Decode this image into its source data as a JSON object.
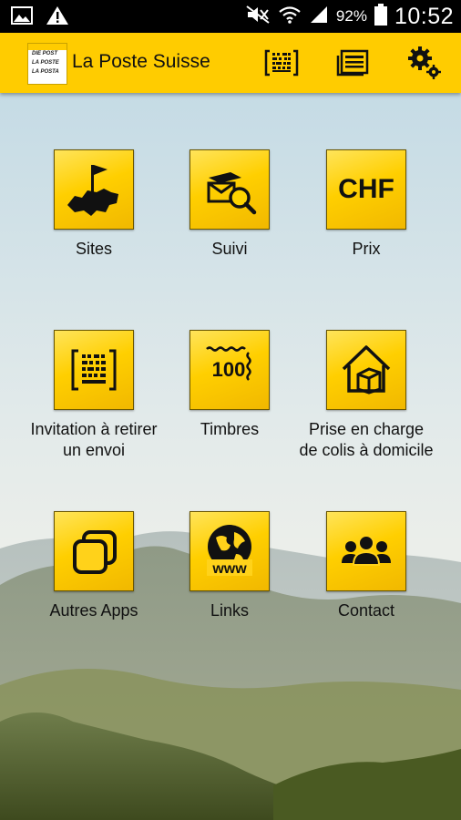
{
  "status_bar": {
    "battery_percent": "92%",
    "time": "10:52",
    "icons": [
      "image-icon",
      "warning-icon",
      "mute-icon",
      "wifi-icon",
      "signal-icon",
      "battery-icon"
    ]
  },
  "app_bar": {
    "title": "La Poste Suisse",
    "logo_lines": [
      "DIE POST",
      "LA POSTE",
      "LA POSTA"
    ],
    "actions": [
      "barcode-scan-icon",
      "news-icon",
      "settings-icon"
    ]
  },
  "tiles": [
    {
      "label": "Sites",
      "icon": "swiss-map-flag-icon"
    },
    {
      "label": "Suivi",
      "icon": "parcel-search-icon"
    },
    {
      "label": "Prix",
      "icon": "chf-icon",
      "icon_text": "CHF"
    },
    {
      "label": "Invitation à retirer un envoi",
      "icon": "barcode-icon"
    },
    {
      "label": "Timbres",
      "icon": "stamp-icon",
      "icon_text": "100"
    },
    {
      "label": "Prise en charge de colis à domicile",
      "icon": "house-parcel-icon"
    },
    {
      "label": "Autres Apps",
      "icon": "apps-stack-icon"
    },
    {
      "label": "Links",
      "icon": "globe-www-icon",
      "icon_text": "www"
    },
    {
      "label": "Contact",
      "icon": "people-icon"
    }
  ],
  "colors": {
    "brand_yellow": "#ffcc00",
    "status_bar": "#000000"
  }
}
